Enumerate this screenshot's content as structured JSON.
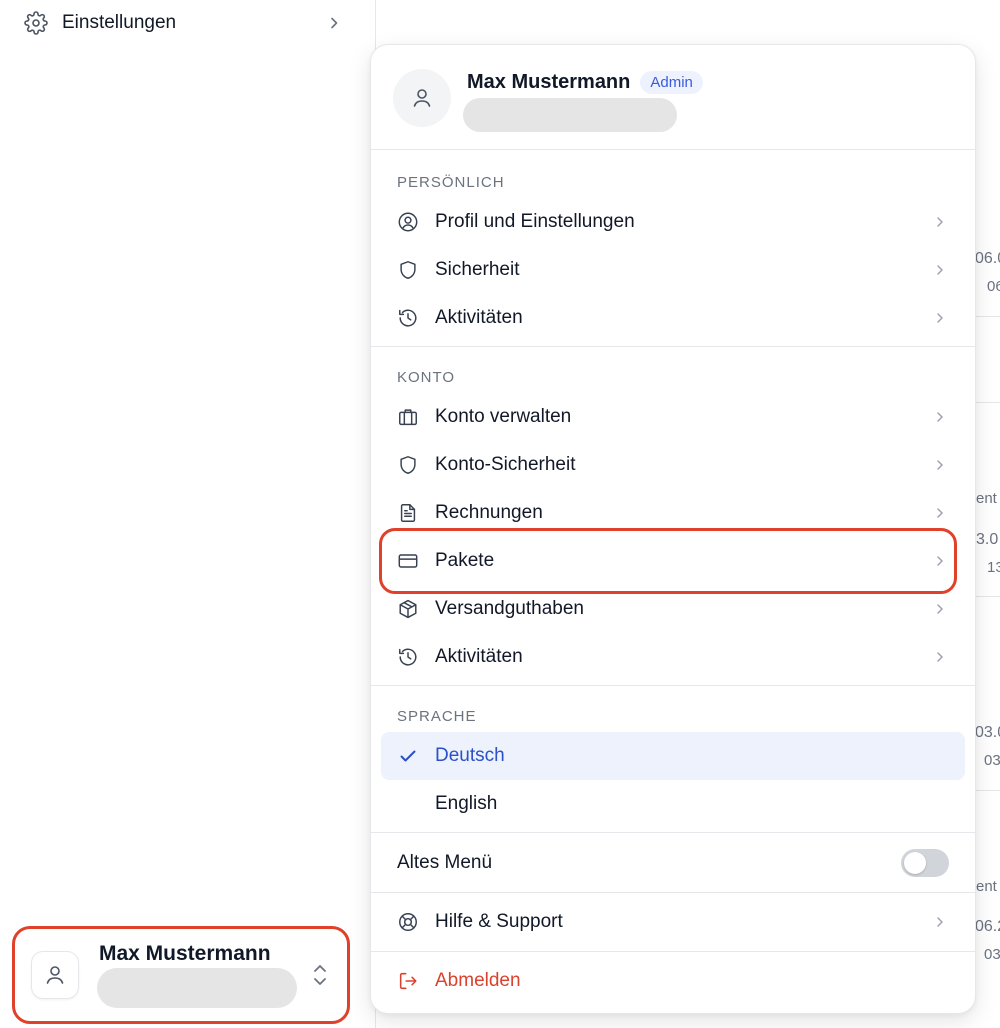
{
  "sidebar": {
    "settings_label": "Einstellungen",
    "user": {
      "name": "Max Mustermann"
    }
  },
  "background_fragments": [
    "06.0",
    "06",
    "ent",
    "3.0",
    "13",
    "03.0",
    "03",
    "ent",
    "06.2",
    "03"
  ],
  "menu": {
    "header": {
      "name": "Max Mustermann",
      "badge": "Admin"
    },
    "sections": {
      "personal": {
        "title": "PERSÖNLICH",
        "items": [
          {
            "label": "Profil und Einstellungen",
            "icon": "user-circle-icon"
          },
          {
            "label": "Sicherheit",
            "icon": "shield-icon"
          },
          {
            "label": "Aktivitäten",
            "icon": "history-icon"
          }
        ]
      },
      "account": {
        "title": "KONTO",
        "items": [
          {
            "label": "Konto verwalten",
            "icon": "briefcase-icon"
          },
          {
            "label": "Konto-Sicherheit",
            "icon": "shield-icon"
          },
          {
            "label": "Rechnungen",
            "icon": "document-icon"
          },
          {
            "label": "Pakete",
            "icon": "credit-card-icon"
          },
          {
            "label": "Versandguthaben",
            "icon": "box-icon"
          },
          {
            "label": "Aktivitäten",
            "icon": "history-icon"
          }
        ]
      },
      "language": {
        "title": "SPRACHE",
        "options": [
          {
            "label": "Deutsch",
            "selected": true
          },
          {
            "label": "English",
            "selected": false
          }
        ]
      }
    },
    "old_menu": {
      "label": "Altes Menü",
      "enabled": false
    },
    "help_label": "Hilfe & Support",
    "logout_label": "Abmelden"
  },
  "colors": {
    "accent": "#2b50c8",
    "highlight_outline": "#e0412b",
    "danger": "#d9422e",
    "badge_bg": "#eef2ff"
  }
}
